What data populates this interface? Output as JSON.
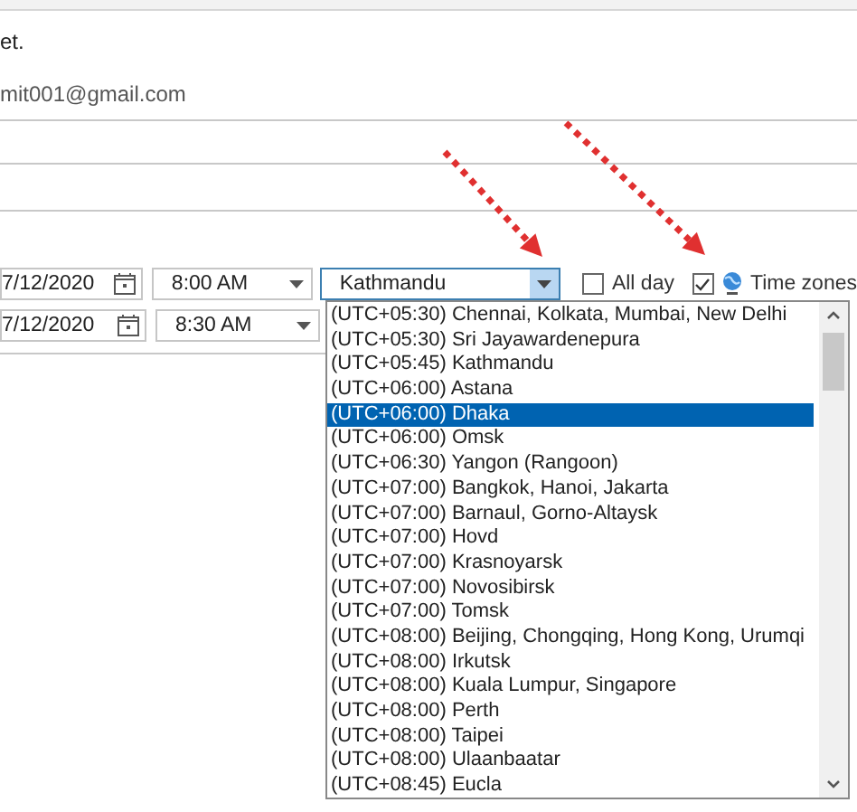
{
  "message": {
    "text": "et."
  },
  "organizer": {
    "email": "mit001@gmail.com"
  },
  "start": {
    "date": "7/12/2020",
    "time": "8:00 AM"
  },
  "end": {
    "date": "7/12/2020",
    "time": "8:30 AM"
  },
  "time_zone": {
    "value": "Kathmandu",
    "options": [
      {
        "label": "(UTC+05:30) Chennai, Kolkata, Mumbai, New Delhi",
        "selected": false
      },
      {
        "label": "(UTC+05:30) Sri Jayawardenepura",
        "selected": false
      },
      {
        "label": "(UTC+05:45) Kathmandu",
        "selected": false
      },
      {
        "label": "(UTC+06:00) Astana",
        "selected": false
      },
      {
        "label": "(UTC+06:00) Dhaka",
        "selected": true
      },
      {
        "label": "(UTC+06:00) Omsk",
        "selected": false
      },
      {
        "label": "(UTC+06:30) Yangon (Rangoon)",
        "selected": false
      },
      {
        "label": "(UTC+07:00) Bangkok, Hanoi, Jakarta",
        "selected": false
      },
      {
        "label": "(UTC+07:00) Barnaul, Gorno-Altaysk",
        "selected": false
      },
      {
        "label": "(UTC+07:00) Hovd",
        "selected": false
      },
      {
        "label": "(UTC+07:00) Krasnoyarsk",
        "selected": false
      },
      {
        "label": "(UTC+07:00) Novosibirsk",
        "selected": false
      },
      {
        "label": "(UTC+07:00) Tomsk",
        "selected": false
      },
      {
        "label": "(UTC+08:00) Beijing, Chongqing, Hong Kong, Urumqi",
        "selected": false
      },
      {
        "label": "(UTC+08:00) Irkutsk",
        "selected": false
      },
      {
        "label": "(UTC+08:00) Kuala Lumpur, Singapore",
        "selected": false
      },
      {
        "label": "(UTC+08:00) Perth",
        "selected": false
      },
      {
        "label": "(UTC+08:00) Taipei",
        "selected": false
      },
      {
        "label": "(UTC+08:00) Ulaanbaatar",
        "selected": false
      },
      {
        "label": "(UTC+08:45) Eucla",
        "selected": false
      }
    ]
  },
  "all_day": {
    "label": "All day",
    "checked": false
  },
  "time_zones": {
    "label": "Time zones",
    "checked": true
  }
}
